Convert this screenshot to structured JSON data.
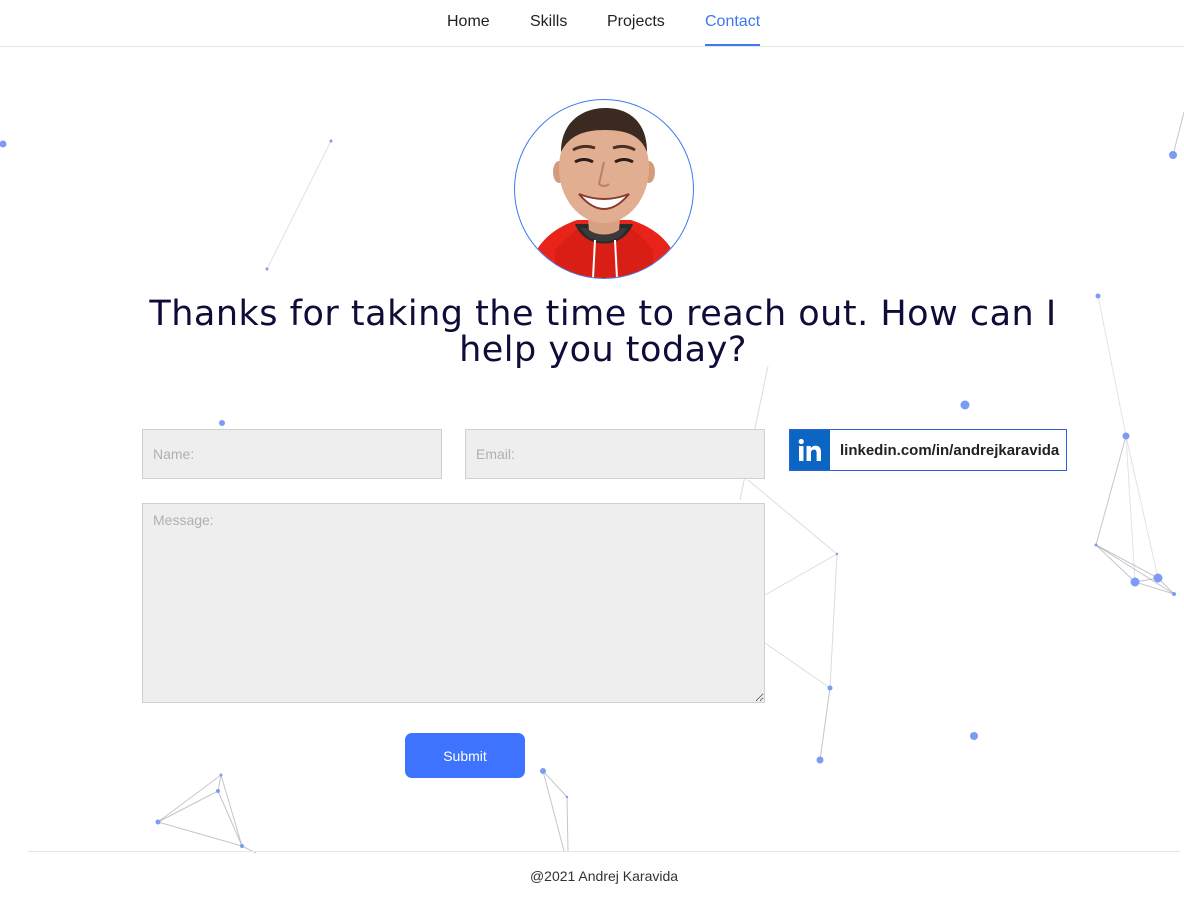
{
  "nav": {
    "items": [
      {
        "label": "Home",
        "active": false
      },
      {
        "label": "Skills",
        "active": false
      },
      {
        "label": "Projects",
        "active": false
      },
      {
        "label": "Contact",
        "active": true
      }
    ]
  },
  "hero": {
    "headline": "Thanks for taking the time to reach out. How can I help you today?"
  },
  "form": {
    "name_placeholder": "Name:",
    "email_placeholder": "Email:",
    "message_placeholder": "Message:",
    "submit_label": "Submit"
  },
  "social": {
    "linkedin_label": "linkedin.com/in/andrejkaravida",
    "linkedin_icon": "in"
  },
  "footer": {
    "text": "@2021 Andrej Karavida"
  },
  "colors": {
    "accent": "#3d78f0",
    "button": "#3d73ff",
    "headline": "#0e0c38",
    "linkedin": "#0a66c2"
  }
}
